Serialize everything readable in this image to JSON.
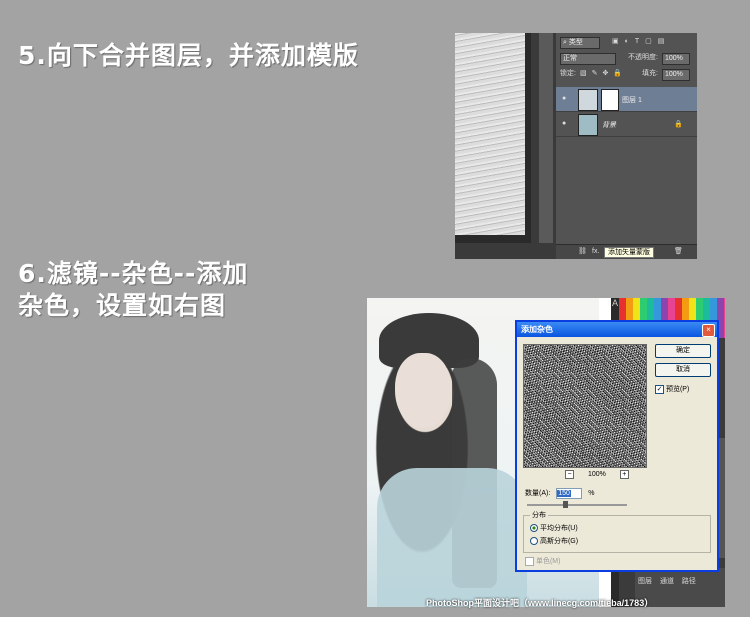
{
  "headings": {
    "step5": "5.向下合并图层，并添加模版",
    "step6_line1": "6.滤镜--杂色--添加",
    "step6_line2": "杂色，设置如右图"
  },
  "layers_panel": {
    "filter_type": "类型",
    "blend_mode": "正常",
    "opacity_label": "不透明度:",
    "opacity_value": "100%",
    "lock_label": "锁定:",
    "fill_label": "填充:",
    "fill_value": "100%",
    "layers": [
      {
        "name": "图层 1",
        "selected": true,
        "has_mask": true
      },
      {
        "name": "背景",
        "selected": false,
        "locked": true
      }
    ],
    "bottom_fx": "fx.",
    "tooltip": "添加矢量蒙版"
  },
  "noise_dialog": {
    "title": "添加杂色",
    "close": "×",
    "ok_label": "确定",
    "cancel_label": "取消",
    "preview_label": "预览(P)",
    "preview_checked": true,
    "zoom_minus": "−",
    "zoom_value": "100%",
    "zoom_plus": "+",
    "amount_label": "数量(A):",
    "amount_value": "150",
    "amount_unit": "%",
    "distribution_title": "分布",
    "distribution_options": [
      {
        "label": "平均分布(U)",
        "selected": true
      },
      {
        "label": "高斯分布(G)",
        "selected": false
      }
    ],
    "monochrome_label": "单色(M)",
    "monochrome_checked": false
  },
  "right_panel": {
    "side_letter": "A",
    "tabs": [
      "图层",
      "通道",
      "路径"
    ]
  },
  "watermark": "PhotoShop平面设计吧（www.linecg.com/tieba/1783）",
  "colors": {
    "background": "#a3a3a3",
    "selected_layer": "#6d7e95",
    "dialog_title": "#0a55e0",
    "dialog_body": "#ece9d8"
  }
}
